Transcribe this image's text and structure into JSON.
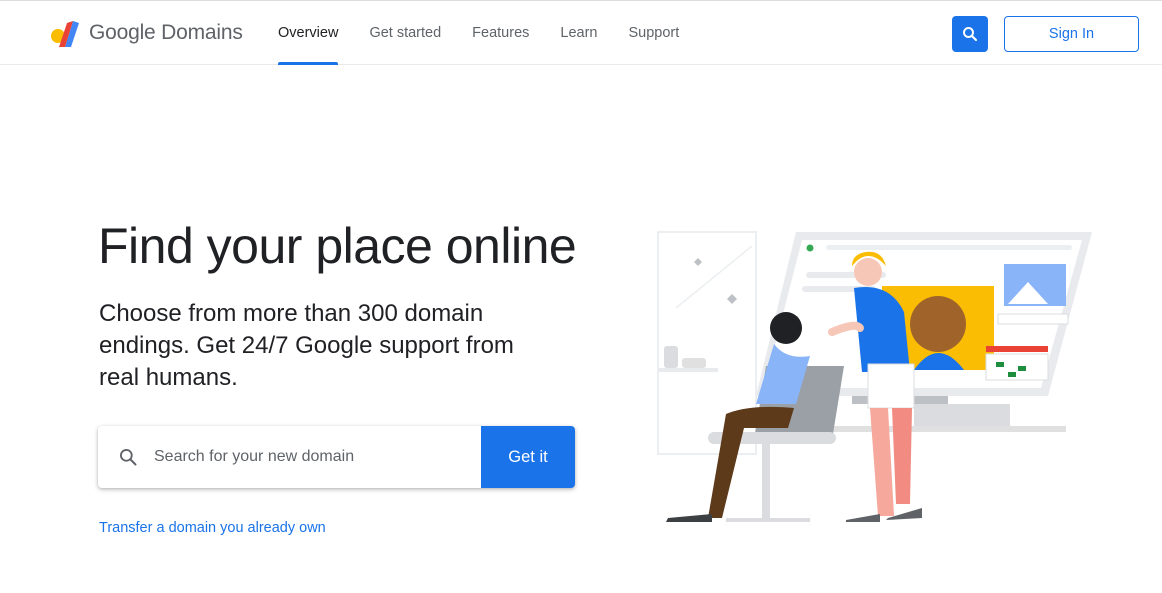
{
  "header": {
    "brand": "Google Domains",
    "nav": [
      {
        "label": "Overview",
        "active": true
      },
      {
        "label": "Get started",
        "active": false
      },
      {
        "label": "Features",
        "active": false
      },
      {
        "label": "Learn",
        "active": false
      },
      {
        "label": "Support",
        "active": false
      }
    ],
    "search_icon": "search-icon",
    "signin_label": "Sign In"
  },
  "hero": {
    "headline": "Find your place online",
    "subhead": "Choose from more than 300 domain endings. Get 24/7 Google support from real humans.",
    "search": {
      "placeholder": "Search for your new domain",
      "value": "",
      "button_label": "Get it"
    },
    "transfer_link": "Transfer a domain you already own"
  },
  "colors": {
    "accent": "#1a73e8",
    "text": "#202124",
    "muted": "#5f6368"
  }
}
